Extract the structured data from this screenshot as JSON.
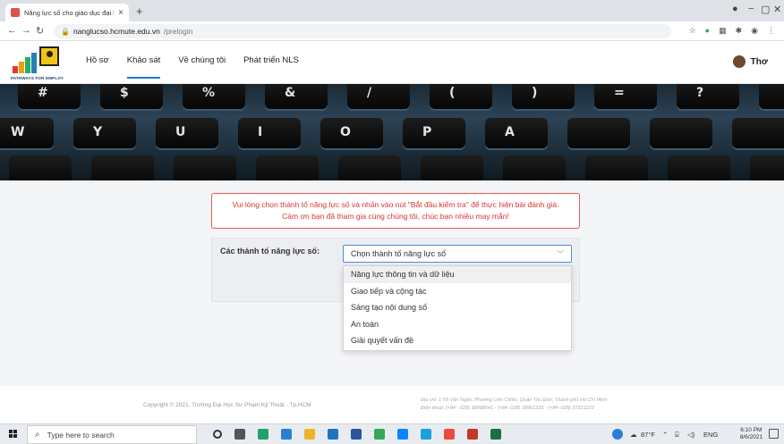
{
  "browser": {
    "tab_title": "Năng lực số cho giáo dục đại học",
    "tab_close": "×",
    "new_tab": "+",
    "url_host": "nanglucso.hcmute.edu.vn",
    "url_path": "/prelogin"
  },
  "site": {
    "logo_text": "PATHWAYS FOR EMPLOY",
    "nav": [
      "Hồ sơ",
      "Khảo sát",
      "Về chúng tôi",
      "Phát triển NLS"
    ],
    "active_nav": "Khảo sát",
    "username": "Thơ"
  },
  "banner": {
    "key_labels": [
      "#",
      "$",
      "%",
      "&",
      "/",
      "(",
      ")",
      "=",
      "?",
      "W",
      "Y",
      "U",
      "I",
      "O",
      "P",
      "A"
    ]
  },
  "notice": {
    "line1": "Vui lòng chọn thành tố năng lực số và nhấn vào nút \"Bắt đầu kiểm tra\" để thực hiện bài đánh giá.",
    "line2": "Cảm ơn bạn đã tham gia cùng chúng tôi, chúc bạn nhiều may mắn!"
  },
  "form": {
    "label": "Các thành tố năng lực số:",
    "select_value": "Chọn thành tố năng lực số",
    "options": [
      "Năng lực thông tin và dữ liệu",
      "Giao tiếp và cộng tác",
      "Sáng tạo nội dung số",
      "An toàn",
      "Giải quyết vấn đề"
    ]
  },
  "footer": {
    "copyright": "Copyright © 2021, Trường Đại Học Sư Phạm Kỹ Thuật - Tp.HCM",
    "address_line1": "Địa chỉ: 1 Võ Văn Ngân, Phường Linh Chiểu, Quận Thủ Đức, Thành phố Hồ Chí Minh",
    "address_line2": "Điện thoại: (+84 - 028) 38968641 - (+84 -028) 38961333 - (+84 -028) 37221223"
  },
  "taskbar": {
    "search_placeholder": "Type here to search",
    "weather": "87°F",
    "language": "ENG",
    "time": "6:10 PM",
    "date": "8/6/2021"
  },
  "colors": {
    "accent": "#1f77d0",
    "alert": "#d9342b",
    "alert_border": "#e85a4f"
  }
}
